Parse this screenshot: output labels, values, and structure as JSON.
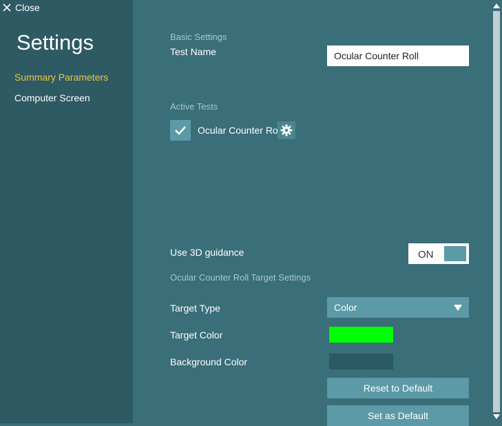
{
  "sidebar": {
    "close_label": "Close",
    "title": "Settings",
    "items": [
      {
        "label": "Summary Parameters",
        "active": true
      },
      {
        "label": "Computer Screen",
        "active": false
      }
    ]
  },
  "basic_settings": {
    "header": "Basic Settings",
    "test_name_label": "Test Name",
    "test_name_value": "Ocular Counter Roll"
  },
  "active_tests": {
    "header": "Active Tests",
    "items": [
      {
        "label": "Ocular Counter Roll",
        "checked": true
      }
    ]
  },
  "guidance": {
    "label": "Use 3D guidance",
    "toggle_state": "ON"
  },
  "target_settings": {
    "header": "Ocular Counter Roll Target Settings",
    "target_type_label": "Target Type",
    "target_type_value": "Color",
    "target_color_label": "Target Color",
    "target_color": "#00ff00",
    "background_color_label": "Background Color",
    "background_color": "#2b5a63"
  },
  "buttons": {
    "reset": "Reset to Default",
    "set_default": "Set as Default"
  },
  "colors": {
    "accent": "#f2c43d",
    "button": "#5b9aa6",
    "panel": "#3a6e78",
    "sidebar": "#2d5a63"
  },
  "icons": {
    "close": "close-icon",
    "check": "checkmark-icon",
    "settings": "gear-icon",
    "dropdown": "triangle-down-icon"
  }
}
